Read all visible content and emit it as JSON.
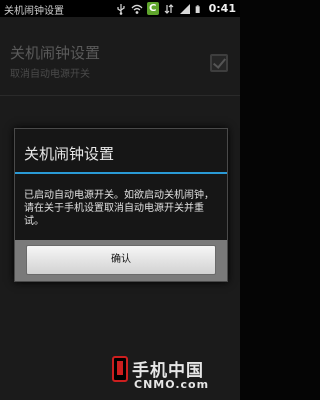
{
  "status_bar": {
    "title": "关机闹钟设置",
    "time": "0:41",
    "app_badge": "C",
    "icons": [
      "usb-icon",
      "wifi-icon",
      "app-c-icon",
      "data-sync-icon",
      "signal-icon",
      "battery-icon"
    ]
  },
  "setting": {
    "title": "关机闹钟设置",
    "summary": "取消自动电源开关",
    "checked": true
  },
  "dialog": {
    "title": "关机闹钟设置",
    "message": "已启动自动电源开关。如欲启动关机闹钟，请在关于手机设置取消自动电源开关并重试。",
    "ok_label": "确认",
    "accent_color": "#2a9ad6"
  },
  "watermark": {
    "text_cn": "手机中国",
    "text_en": "CNMO.com"
  }
}
